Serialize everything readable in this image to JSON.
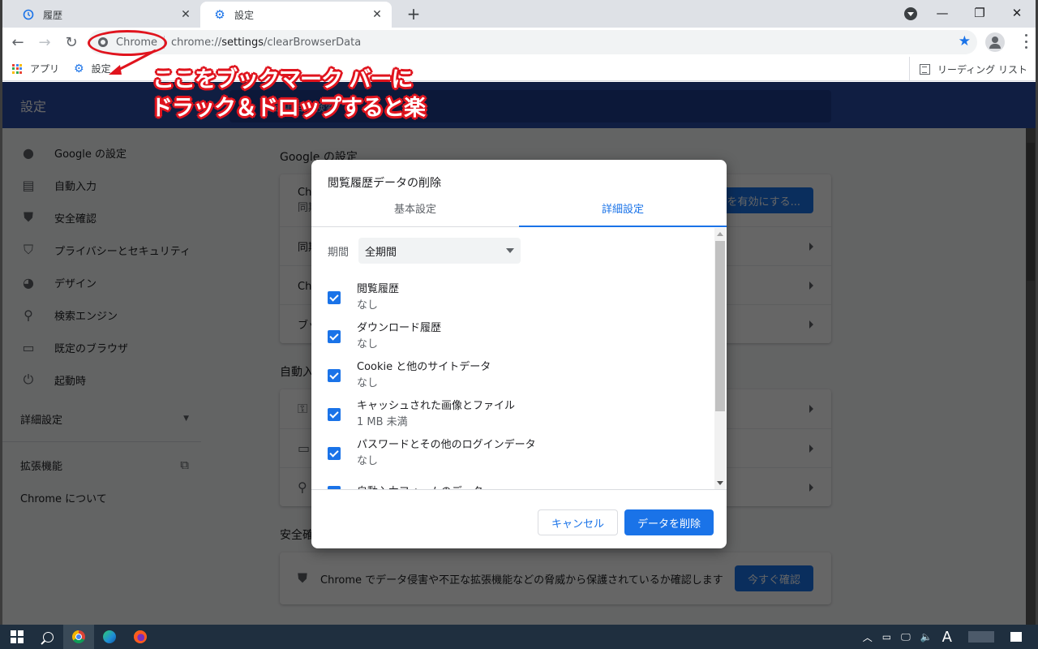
{
  "browser": {
    "tabs": [
      {
        "title": "履歴",
        "icon": "history-icon",
        "active": false
      },
      {
        "title": "設定",
        "icon": "gear-icon",
        "active": true
      }
    ],
    "new_tab_glyph": "+",
    "window_controls": {
      "minimize": "—",
      "restore": "❐",
      "close": "✕"
    },
    "nav": {
      "back": "←",
      "forward": "→",
      "reload": "↻"
    },
    "omnibox": {
      "chip_label": "Chrome",
      "url_prefix": "chrome://",
      "url_host": "settings",
      "url_path": "/clearBrowserData"
    },
    "bookmarks": [
      {
        "label": "アプリ",
        "icon": "apps-grid-icon"
      },
      {
        "label": "設定",
        "icon": "gear-icon"
      }
    ],
    "reading_list_label": "リーディング リスト",
    "accent_color": "#1a73e8"
  },
  "settings": {
    "header_title": "設定",
    "search_placeholder": "設定項目を検索",
    "sidebar": [
      {
        "label": "Google の設定",
        "icon": "person-icon",
        "glyph": "●"
      },
      {
        "label": "自動入力",
        "icon": "clipboard-icon",
        "glyph": "▤"
      },
      {
        "label": "安全確認",
        "icon": "shield-check-icon",
        "glyph": "⛊"
      },
      {
        "label": "プライバシーとセキュリティ",
        "icon": "shield-half-icon",
        "glyph": "⛉"
      },
      {
        "label": "デザイン",
        "icon": "palette-icon",
        "glyph": "◕"
      },
      {
        "label": "検索エンジン",
        "icon": "search-icon",
        "glyph": "⚲"
      },
      {
        "label": "既定のブラウザ",
        "icon": "browser-window-icon",
        "glyph": "▭"
      },
      {
        "label": "起動時",
        "icon": "power-icon",
        "glyph": "⏻"
      }
    ],
    "sidebar_advanced": "詳細設定",
    "sidebar_extensions": "拡張機能",
    "sidebar_about": "Chrome について",
    "sections": {
      "google": {
        "title": "Google の設定",
        "rows": [
          "Chrome",
          "同期",
          "Chrome の名前と画像",
          "ブックマークと設定のインポート"
        ],
        "row1_sub": "同期",
        "sync_button": "同期を有効にする..."
      },
      "autofill": {
        "title": "自動入力"
      },
      "safety": {
        "title": "安全確認",
        "description": "Chrome でデータ侵害や不正な拡張機能などの脅威から保護されているか確認します",
        "button": "今すぐ確認"
      }
    }
  },
  "dialog": {
    "title": "閲覧履歴データの削除",
    "tabs": [
      {
        "label": "基本設定",
        "active": false
      },
      {
        "label": "詳細設定",
        "active": true
      }
    ],
    "period_label": "期間",
    "period_value": "全期間",
    "items": [
      {
        "label": "閲覧履歴",
        "detail": "なし",
        "checked": true
      },
      {
        "label": "ダウンロード履歴",
        "detail": "なし",
        "checked": true
      },
      {
        "label": "Cookie と他のサイトデータ",
        "detail": "なし",
        "checked": true
      },
      {
        "label": "キャッシュされた画像とファイル",
        "detail": "1 MB 未満",
        "checked": true
      },
      {
        "label": "パスワードとその他のログインデータ",
        "detail": "なし",
        "checked": true
      },
      {
        "label": "自動入力フォームのデータ",
        "detail": "",
        "checked": true
      }
    ],
    "cancel_label": "キャンセル",
    "delete_label": "データを削除"
  },
  "annotation": {
    "line1": "ここをブックマーク バーに",
    "line2": "ドラック＆ドロップすると楽",
    "color": "#e0141e"
  },
  "taskbar": {
    "apps": [
      "start-button",
      "search",
      "chrome",
      "edge",
      "firefox"
    ],
    "ime_indicator": "A"
  }
}
